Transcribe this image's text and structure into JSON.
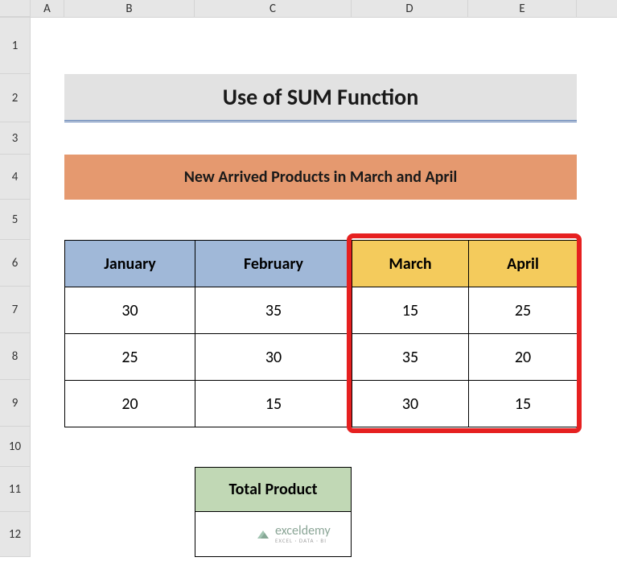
{
  "columns": {
    "A": "A",
    "B": "B",
    "C": "C",
    "D": "D",
    "E": "E"
  },
  "rows": {
    "r1": "1",
    "r2": "2",
    "r3": "3",
    "r4": "4",
    "r5": "5",
    "r6": "6",
    "r7": "7",
    "r8": "8",
    "r9": "9",
    "r10": "10",
    "r11": "11",
    "r12": "12"
  },
  "title": "Use of SUM Function",
  "subtitle": "New Arrived Products in March and April",
  "table": {
    "headers": {
      "jan": "January",
      "feb": "February",
      "mar": "March",
      "apr": "April"
    },
    "rows": [
      {
        "jan": "30",
        "feb": "35",
        "mar": "15",
        "apr": "25"
      },
      {
        "jan": "25",
        "feb": "30",
        "mar": "35",
        "apr": "20"
      },
      {
        "jan": "20",
        "feb": "15",
        "mar": "30",
        "apr": "15"
      }
    ]
  },
  "total": {
    "label": "Total Product",
    "value": ""
  },
  "watermark": {
    "main": "exceldemy",
    "sub": "EXCEL · DATA · BI"
  }
}
